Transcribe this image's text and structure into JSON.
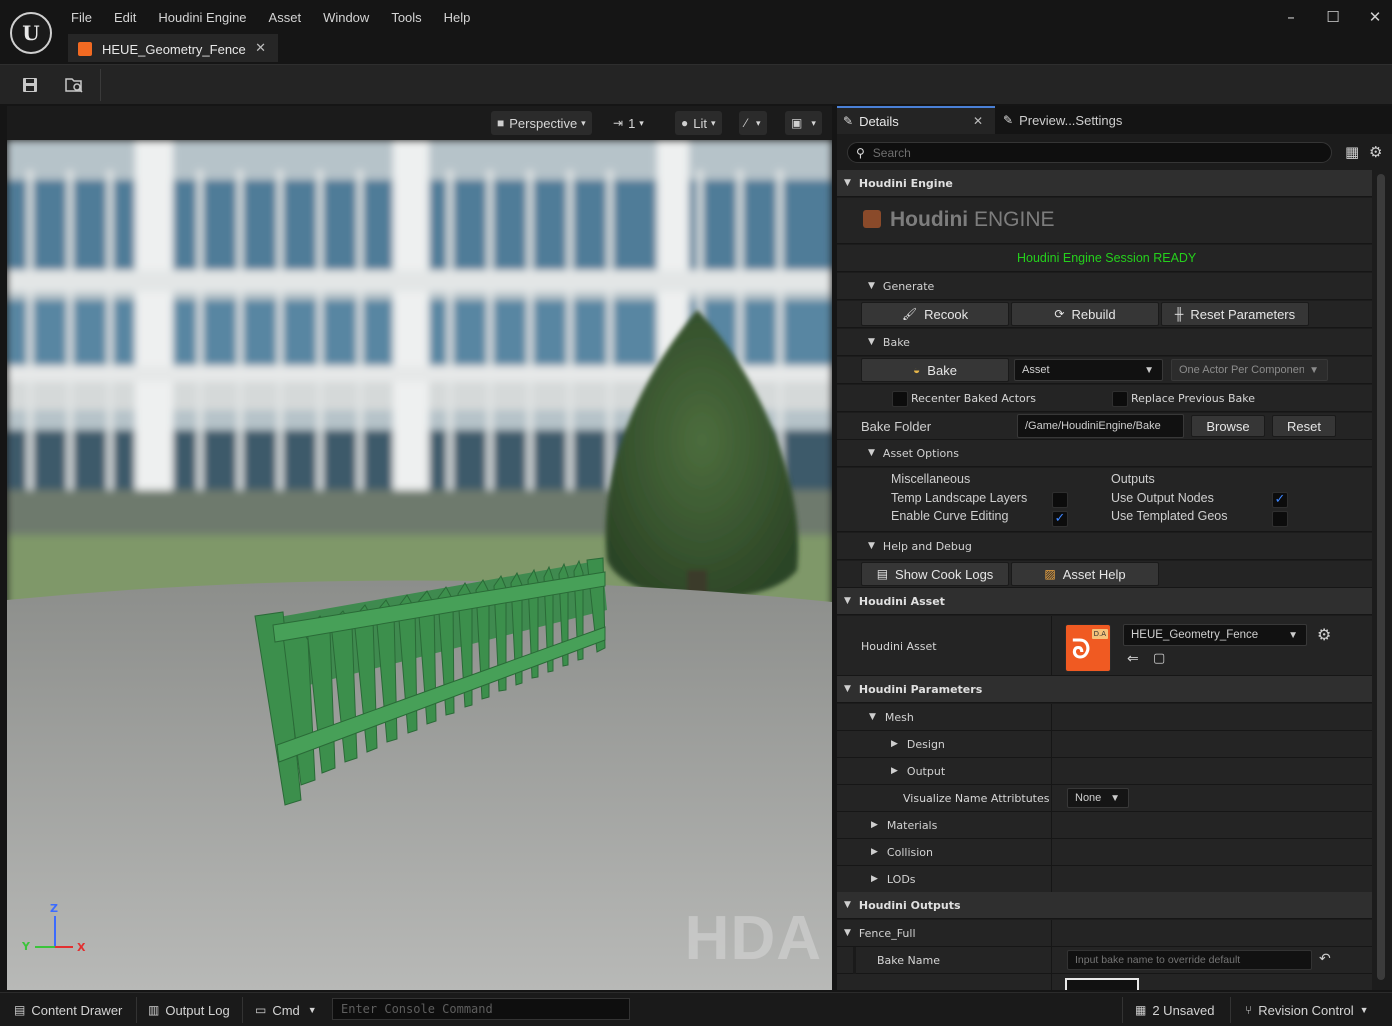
{
  "app": {
    "logo": "unreal-logo",
    "menus": [
      "File",
      "Edit",
      "Houdini Engine",
      "Asset",
      "Window",
      "Tools",
      "Help"
    ],
    "document_tab": "HEUE_Geometry_Fence",
    "window_controls": {
      "minimize": "–",
      "maximize": "☐",
      "close": "✕"
    }
  },
  "toolbar": {
    "save_icon": "save-icon",
    "browse_icon": "browse-asset-icon"
  },
  "viewport": {
    "perspective_label": "Perspective",
    "camera_speed_label": "1",
    "view_mode_label": "Lit",
    "watermark": "HDA",
    "axes": {
      "z": "Z",
      "y": "Y",
      "x": "X"
    }
  },
  "details": {
    "tab_details": "Details",
    "tab_preview": "Preview...Settings",
    "search_placeholder": "Search",
    "houdini_engine": {
      "header": "Houdini Engine",
      "logo_text_1": "Houdini",
      "logo_text_2": "ENGINE",
      "session_status": "Houdini Engine Session READY",
      "session_color": "#25d01c",
      "generate": {
        "header": "Generate",
        "recook": "Recook",
        "rebuild": "Rebuild",
        "reset_parameters": "Reset Parameters"
      },
      "bake": {
        "header": "Bake",
        "bake_button": "Bake",
        "bake_type": "Asset",
        "bake_option": "One Actor Per Componen",
        "recenter_label": "Recenter Baked Actors",
        "recenter_checked": false,
        "replace_label": "Replace Previous Bake",
        "replace_checked": false,
        "bake_folder_label": "Bake Folder",
        "bake_folder_value": "/Game/HoudiniEngine/Bake",
        "browse": "Browse",
        "reset": "Reset"
      },
      "asset_options": {
        "header": "Asset Options",
        "misc_header": "Miscellaneous",
        "outputs_header": "Outputs",
        "temp_landscape_label": "Temp Landscape Layers",
        "temp_landscape_checked": false,
        "enable_curve_label": "Enable Curve Editing",
        "enable_curve_checked": true,
        "use_output_nodes_label": "Use Output Nodes",
        "use_output_nodes_checked": true,
        "use_templated_label": "Use Templated Geos",
        "use_templated_checked": false
      },
      "help_debug": {
        "header": "Help and Debug",
        "show_cook_logs": "Show Cook Logs",
        "asset_help": "Asset Help"
      }
    },
    "houdini_asset": {
      "header": "Houdini Asset",
      "label": "Houdini Asset",
      "value": "HEUE_Geometry_Fence",
      "thumb_badge": "D.A"
    },
    "houdini_parameters": {
      "header": "Houdini Parameters",
      "mesh": "Mesh",
      "design": "Design",
      "output": "Output",
      "visualize_label": "Visualize Name Attribtutes",
      "visualize_value": "None",
      "materials": "Materials",
      "collision": "Collision",
      "lods": "LODs"
    },
    "houdini_outputs": {
      "header": "Houdini Outputs",
      "fence_full": "Fence_Full",
      "bake_name_label": "Bake Name",
      "bake_name_placeholder": "Input bake name to override default"
    }
  },
  "statusbar": {
    "content_drawer": "Content Drawer",
    "output_log": "Output Log",
    "cmd": "Cmd",
    "console_placeholder": "Enter Console Command",
    "unsaved": "2 Unsaved",
    "revision_control": "Revision Control"
  }
}
